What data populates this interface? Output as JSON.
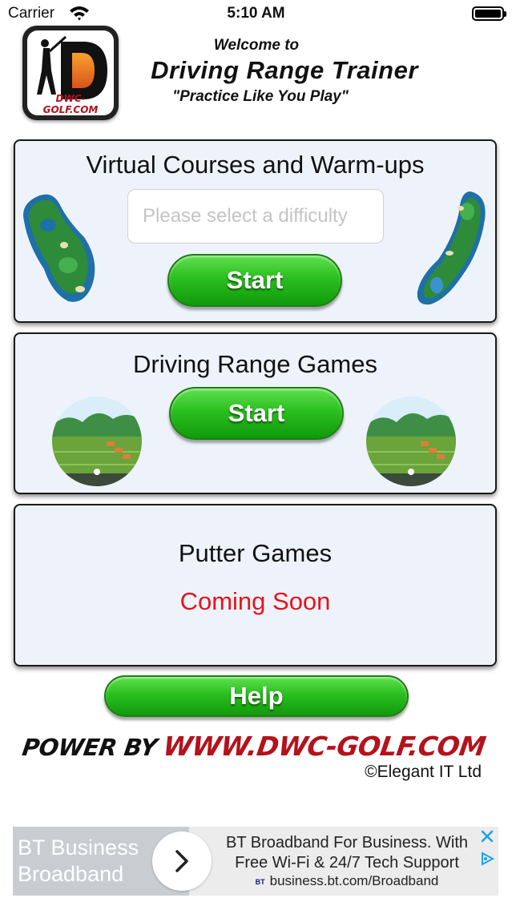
{
  "status_bar": {
    "carrier": "Carrier",
    "time": "5:10 AM"
  },
  "header": {
    "logo_text": "DWC-GOLF.COM",
    "logo_letter": "D",
    "welcome": "Welcome to",
    "title": "Driving Range Trainer",
    "tagline": "\"Practice Like You Play\""
  },
  "virtual_courses": {
    "title": "Virtual Courses and Warm-ups",
    "difficulty_placeholder": "Please select a difficulty",
    "start_label": "Start"
  },
  "range_games": {
    "title": "Driving Range Games",
    "start_label": "Start"
  },
  "putter_games": {
    "title": "Putter Games",
    "status": "Coming Soon"
  },
  "help_label": "Help",
  "footer": {
    "powered_by": "POWER BY",
    "url": "WWW.DWC-GOLF.COM",
    "copyright": "©Elegant IT Ltd"
  },
  "ad": {
    "brand": "BT Business Broadband",
    "headline": "BT Broadband For Business. With Free Wi-Fi & 24/7 Tech Support",
    "bt_logo": "BT",
    "url": "business.bt.com/Broadband"
  },
  "colors": {
    "accent_green": "#2bbf1f",
    "coming_soon_red": "#e8131b",
    "panel_bg": "#eef3fb",
    "footer_red": "#b5121b"
  }
}
